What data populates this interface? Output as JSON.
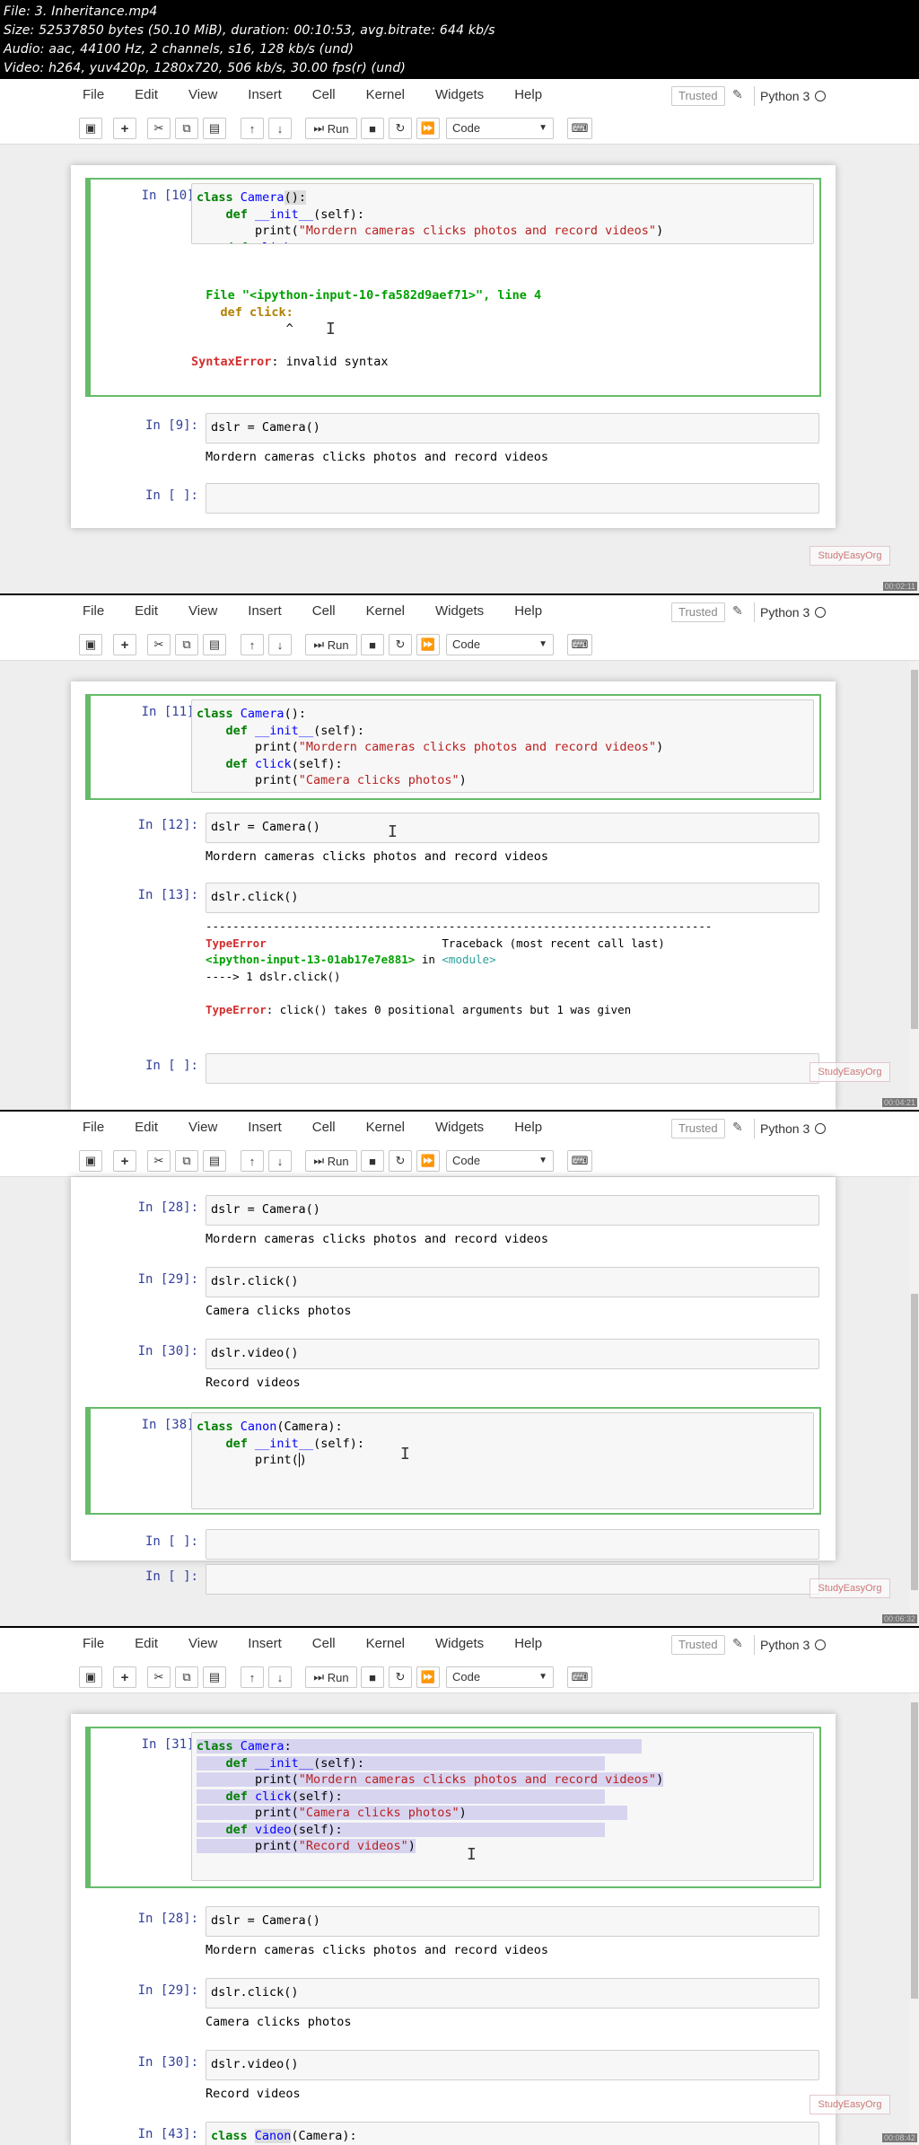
{
  "file_info": {
    "line1": "File: 3. Inheritance.mp4",
    "line2": "Size: 52537850 bytes (50.10 MiB), duration: 00:10:53, avg.bitrate: 644 kb/s",
    "line3": "Audio: aac, 44100 Hz, 2 channels, s16, 128 kb/s (und)",
    "line4": "Video: h264, yuv420p, 1280x720, 506 kb/s, 30.00 fps(r) (und)"
  },
  "menu": [
    "File",
    "Edit",
    "View",
    "Insert",
    "Cell",
    "Kernel",
    "Widgets",
    "Help"
  ],
  "trusted": "Trusted",
  "kernel": "Python 3",
  "toolbar": {
    "run_label": "Run",
    "cell_type": "Code"
  },
  "watermark": "StudyEasyOrg",
  "timecodes": [
    "00:02:11",
    "00:04:21",
    "00:06:32",
    "00:08:42"
  ],
  "frame1": {
    "cell1_prompt": "In [10]:",
    "cell1_error_file": "  File \"<ipython-input-10-fa582d9aef71>\", line 4",
    "cell1_error_code": "    def click:",
    "cell1_error_caret": "             ^",
    "cell1_error_type": "SyntaxError",
    "cell1_error_msg": ": invalid syntax",
    "cell2_prompt": "In [9]:",
    "cell2_code": "dslr = Camera()",
    "cell2_output": "Mordern cameras clicks photos and record videos",
    "cell3_prompt": "In [ ]:"
  },
  "frame2": {
    "cell1_prompt": "In [11]:",
    "cell2_prompt": "In [12]:",
    "cell2_code": "dslr = Camera()",
    "cell2_output": "Mordern cameras clicks photos and record videos",
    "cell3_prompt": "In [13]:",
    "cell3_code": "dslr.click()",
    "cell3_dashes": "---------------------------------------------------------------------------",
    "cell3_err_type": "TypeError",
    "cell3_traceback": "                          Traceback (most recent call last)",
    "cell3_input_ref": "<ipython-input-13-01ab17e7e881>",
    "cell3_in": " in ",
    "cell3_module": "<module>",
    "cell3_arrow": "----> 1 dslr.click()",
    "cell3_err_msg": ": click() takes 0 positional arguments but 1 was given",
    "cell4_prompt": "In [ ]:"
  },
  "frame3": {
    "cell1_prompt": "In [28]:",
    "cell1_code": "dslr = Camera()",
    "cell1_output": "Mordern cameras clicks photos and record videos",
    "cell2_prompt": "In [29]:",
    "cell2_code": "dslr.click()",
    "cell2_output": "Camera clicks photos",
    "cell3_prompt": "In [30]:",
    "cell3_code": "dslr.video()",
    "cell3_output": "Record videos",
    "cell4_prompt": "In [38]:",
    "cell5_prompt": "In [ ]:",
    "cell6_prompt": "In [ ]:"
  },
  "frame4": {
    "cell1_prompt": "In [31]:",
    "cell2_prompt": "In [28]:",
    "cell2_code": "dslr = Camera()",
    "cell2_output": "Mordern cameras clicks photos and record videos",
    "cell3_prompt": "In [29]:",
    "cell3_code": "dslr.click()",
    "cell3_output": "Camera clicks photos",
    "cell4_prompt": "In [30]:",
    "cell4_code": "dslr.video()",
    "cell4_output": "Record videos",
    "cell5_prompt": "In [43]:"
  }
}
